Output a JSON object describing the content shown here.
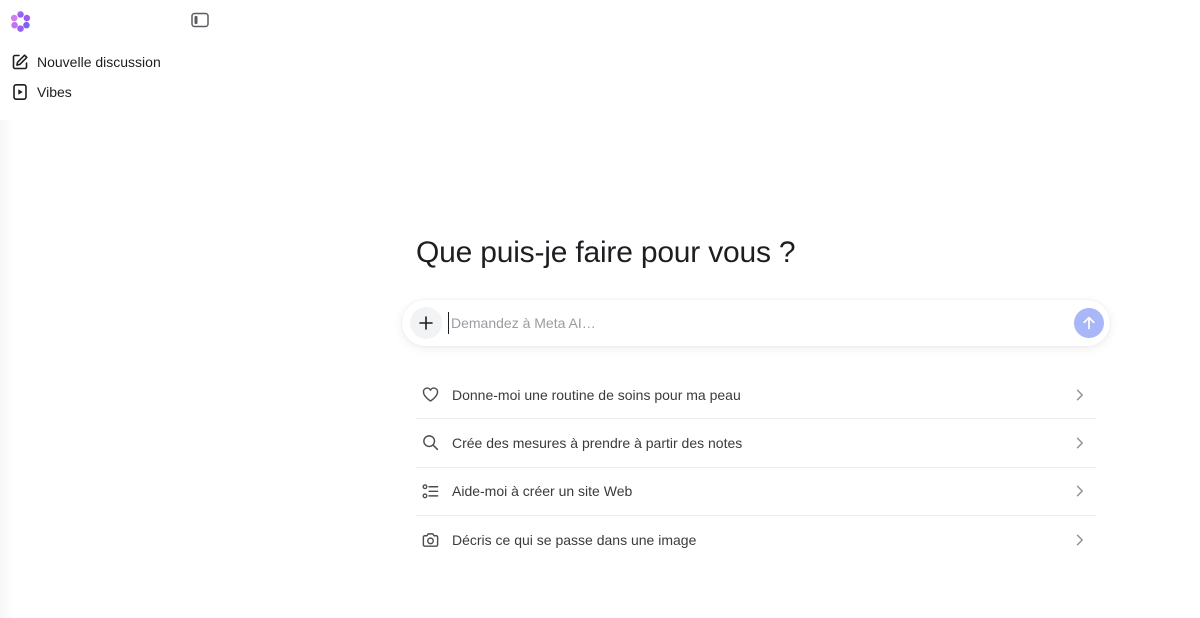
{
  "sidebar": {
    "logo_icon": "meta-ai-flower-icon",
    "toggle_icon": "sidebar-toggle-icon",
    "items": [
      {
        "label": "Nouvelle discussion",
        "icon": "edit-icon"
      },
      {
        "label": "Vibes",
        "icon": "play-square-icon"
      }
    ]
  },
  "main": {
    "headline": "Que puis-je faire pour vous ?",
    "composer": {
      "placeholder": "Demandez à Meta AI…",
      "value": "",
      "plus_icon": "plus-icon",
      "send_icon": "arrow-up-icon",
      "send_color": "#a9b6f7"
    },
    "suggestions": [
      {
        "label": "Donne-moi une routine de soins pour ma peau",
        "icon": "heart-icon"
      },
      {
        "label": "Crée des mesures à prendre à partir des notes",
        "icon": "search-icon"
      },
      {
        "label": "Aide-moi à créer un site Web",
        "icon": "checklist-icon"
      },
      {
        "label": "Décris ce qui se passe dans une image",
        "icon": "camera-icon"
      }
    ]
  }
}
